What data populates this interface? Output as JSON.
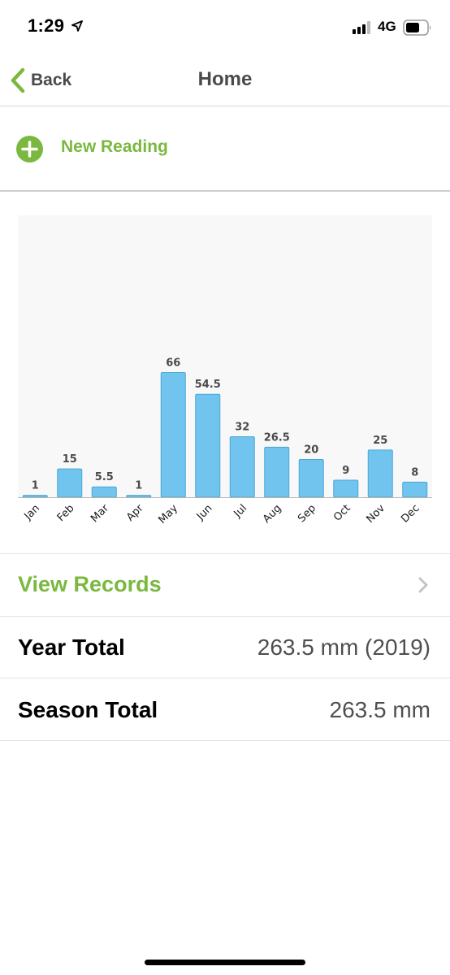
{
  "status_bar": {
    "time": "1:29",
    "network": "4G"
  },
  "nav": {
    "back_label": "Back",
    "title": "Home"
  },
  "new_reading": {
    "label": "New Reading"
  },
  "chart_data": {
    "type": "bar",
    "categories": [
      "Jan",
      "Feb",
      "Mar",
      "Apr",
      "May",
      "Jun",
      "Jul",
      "Aug",
      "Sep",
      "Oct",
      "Nov",
      "Dec"
    ],
    "values": [
      1,
      15,
      5.5,
      1,
      66,
      54.5,
      32,
      26.5,
      20,
      9,
      25,
      8
    ],
    "value_labels": [
      "1",
      "15",
      "5.5",
      "1",
      "66",
      "54.5",
      "32",
      "26.5",
      "20",
      "9",
      "25",
      "8"
    ],
    "title": "",
    "xlabel": "",
    "ylabel": "",
    "ylim": [
      0,
      150
    ],
    "grid": false,
    "bar_color": "#71c4ee",
    "bar_stroke": "#4aa6d6"
  },
  "records": {
    "label": "View Records"
  },
  "totals": [
    {
      "label": "Year Total",
      "value": "263.5 mm (2019)"
    },
    {
      "label": "Season Total",
      "value": "263.5 mm"
    }
  ],
  "colors": {
    "accent": "#7ab83f",
    "text_gray": "#4a4a4a"
  }
}
